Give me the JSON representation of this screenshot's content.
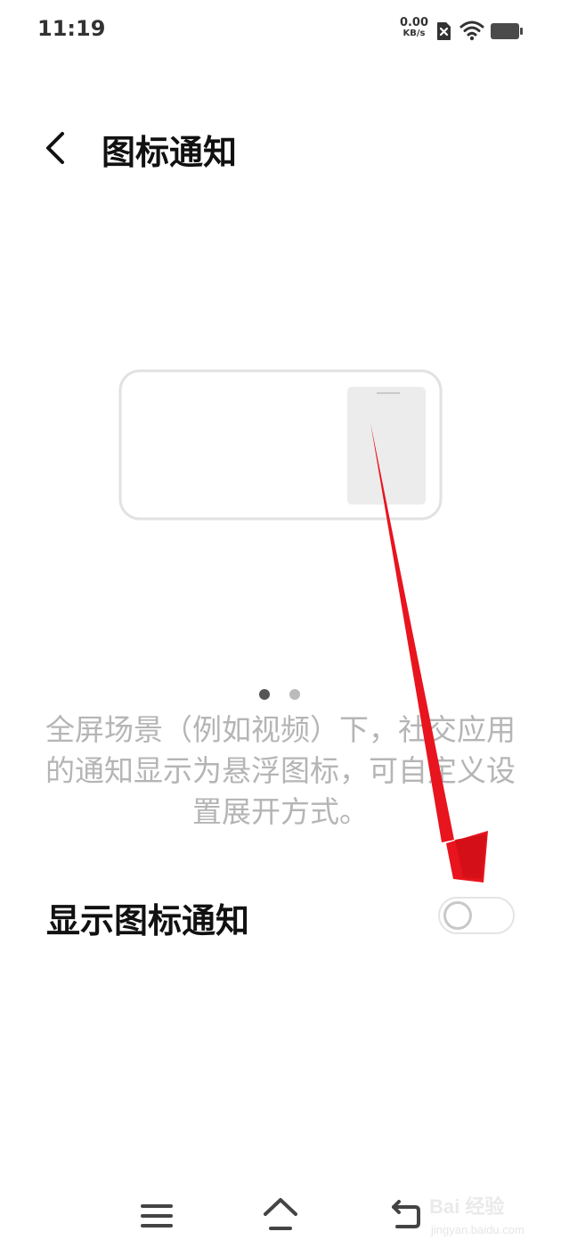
{
  "status_bar": {
    "time": "11:19",
    "net_speed_value": "0.00",
    "net_speed_unit": "KB/s",
    "icons": [
      "sim-off-icon",
      "wifi-icon",
      "battery-icon"
    ]
  },
  "header": {
    "back_icon": "chevron-left-icon",
    "title": "图标通知"
  },
  "illustration": {
    "description": "landscape-phone-with-floating-icon"
  },
  "pager": {
    "total": 2,
    "active_index": 0
  },
  "description": "全屏场景（例如视频）下，社交应用的通知显示为悬浮图标，可自定义设置展开方式。",
  "setting": {
    "label": "显示图标通知",
    "enabled": false
  },
  "nav_bar": {
    "icons": [
      "menu-icon",
      "home-icon",
      "back-icon"
    ]
  },
  "watermark": {
    "logo": "Bai 经验",
    "url": "jingyan.baidu.com"
  },
  "colors": {
    "annotation_arrow": "#e8141e",
    "description_text": "#b5b5b5",
    "illustration_stroke": "#e2e2e2"
  }
}
